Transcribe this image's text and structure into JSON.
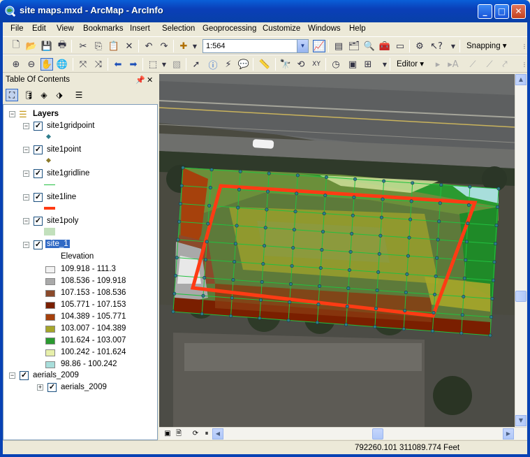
{
  "window": {
    "title": "site maps.mxd - ArcMap - ArcInfo"
  },
  "menu": [
    "File",
    "Edit",
    "View",
    "Bookmarks",
    "Insert",
    "Selection",
    "Geoprocessing",
    "Customize",
    "Windows",
    "Help"
  ],
  "standard_toolbar": {
    "scale": "1:564",
    "snapping_label": "Snapping"
  },
  "tools_toolbar": {
    "editor_label": "Editor"
  },
  "toc": {
    "title": "Table Of Contents",
    "root": "Layers",
    "layers": [
      {
        "name": "site1gridpoint",
        "checked": true
      },
      {
        "name": "site1point",
        "checked": true
      },
      {
        "name": "site1gridline",
        "checked": true
      },
      {
        "name": "site1line",
        "checked": true
      },
      {
        "name": "site1poly",
        "checked": true
      },
      {
        "name": "site_1",
        "checked": true,
        "selected": true
      }
    ],
    "legend_title": "Elevation",
    "legend": [
      {
        "label": "109.918 - 111.3",
        "color": "#f2f2f2"
      },
      {
        "label": "108.536 - 109.918",
        "color": "#a9a9a9"
      },
      {
        "label": "107.153 - 108.536",
        "color": "#8b4a2b"
      },
      {
        "label": "105.771 - 107.153",
        "color": "#7a1f00"
      },
      {
        "label": "104.389 - 105.771",
        "color": "#a6410c"
      },
      {
        "label": "103.007 - 104.389",
        "color": "#a6a62a"
      },
      {
        "label": "101.624 - 103.007",
        "color": "#2a9a30"
      },
      {
        "label": "100.242 - 101.624",
        "color": "#e7efaa"
      },
      {
        "label": "98.86 - 100.242",
        "color": "#a8dedb"
      }
    ],
    "group": {
      "name": "aerials_2009",
      "child": "aerials_2009"
    }
  },
  "status": {
    "coords": "792260.101  311089.774 Feet"
  },
  "colors": {
    "titlebar": "#0a3fb8",
    "selection": "#316ac5",
    "site_line": "#ff3b14",
    "grid": "#22c040",
    "gridpoint": "#2f7d8c"
  }
}
